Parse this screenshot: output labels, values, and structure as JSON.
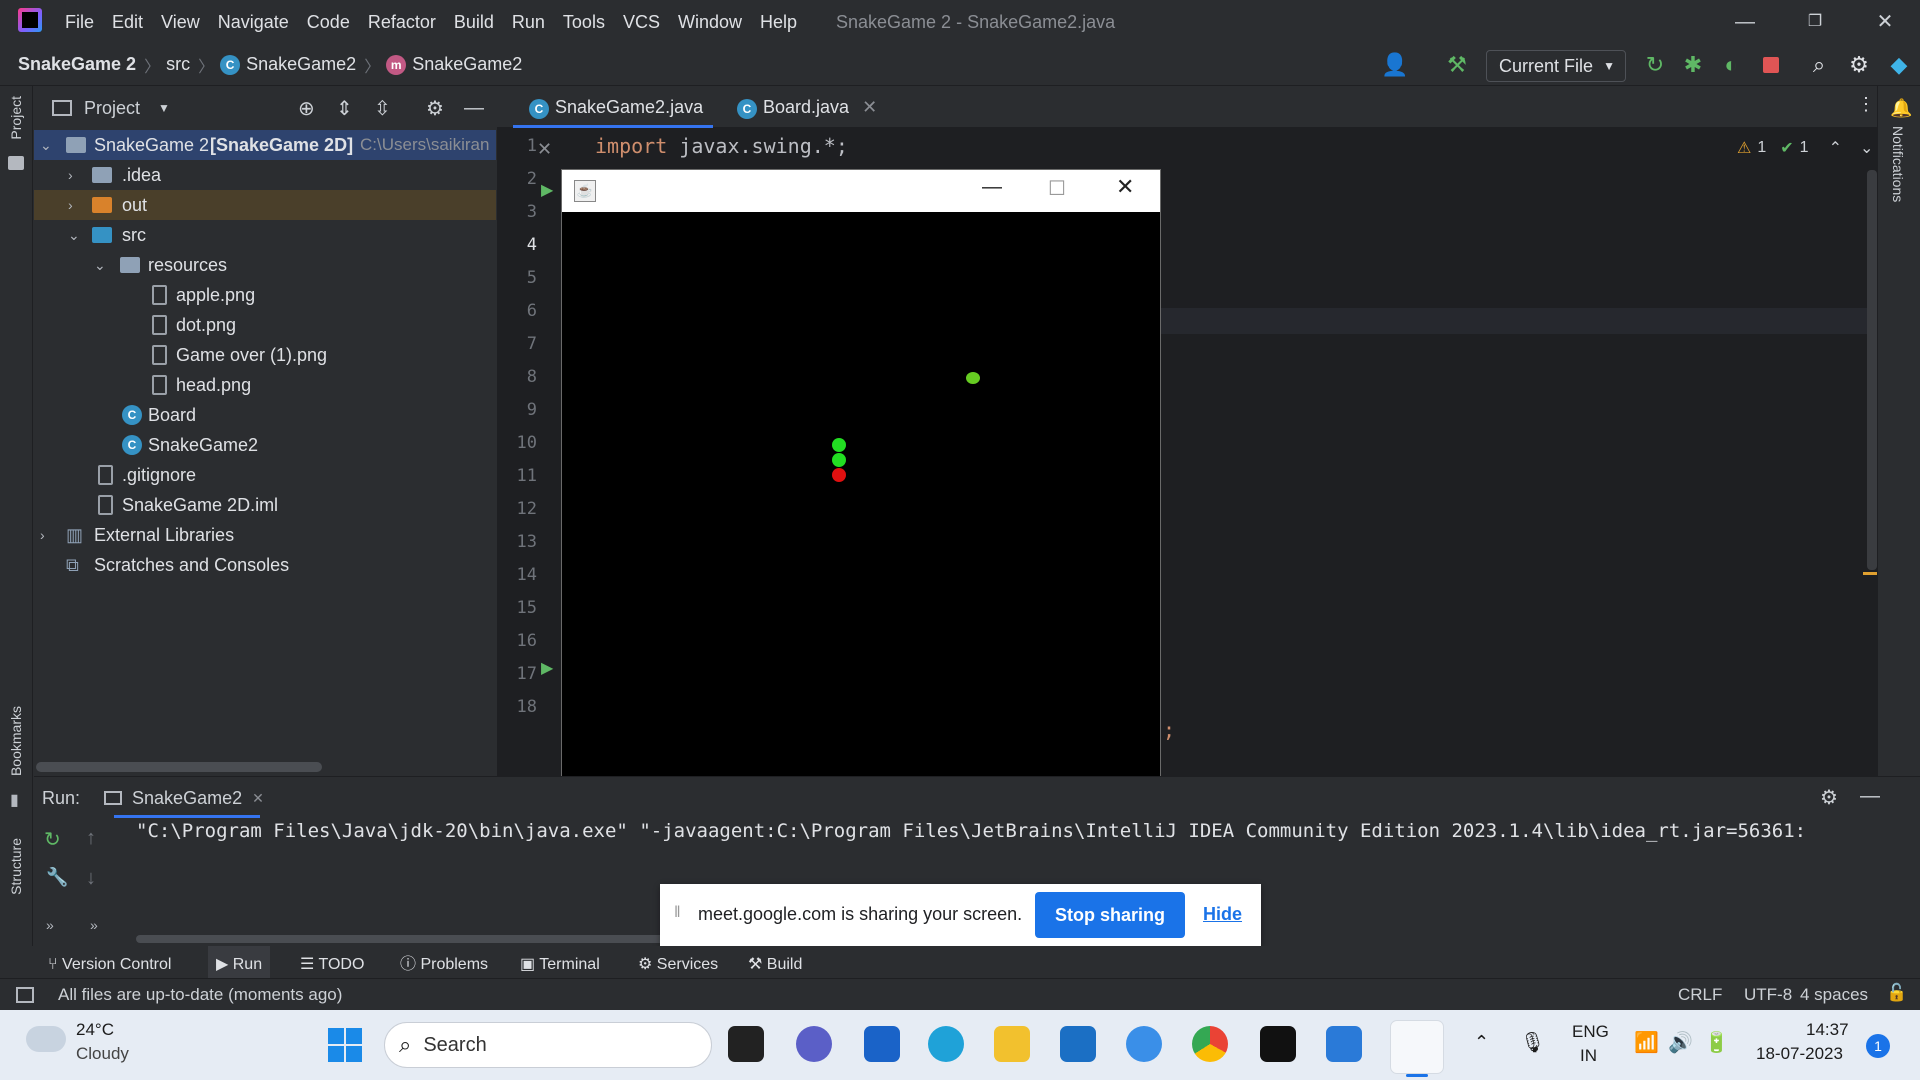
{
  "menu": [
    "File",
    "Edit",
    "View",
    "Navigate",
    "Code",
    "Refactor",
    "Build",
    "Run",
    "Tools",
    "VCS",
    "Window",
    "Help"
  ],
  "window_title": "SnakeGame 2 - SnakeGame2.java",
  "breadcrumb": {
    "project": "SnakeGame 2",
    "src": "src",
    "class1": "SnakeGame2",
    "class2": "SnakeGame2"
  },
  "run_config": "Current File",
  "left_stripe": {
    "project": "Project",
    "bookmarks": "Bookmarks",
    "structure": "Structure"
  },
  "right_stripe": {
    "notifications": "Notifications"
  },
  "project_panel": {
    "title": "Project",
    "root_name": "SnakeGame 2",
    "root_module": "[SnakeGame 2D]",
    "root_path": "C:\\Users\\saikiran",
    "items": [
      {
        "label": "SnakeGame 2",
        "type": "root"
      },
      {
        "label": ".idea",
        "type": "folder"
      },
      {
        "label": "out",
        "type": "folder"
      },
      {
        "label": "src",
        "type": "folder"
      },
      {
        "label": "resources",
        "type": "folder"
      },
      {
        "label": "apple.png",
        "type": "file"
      },
      {
        "label": "dot.png",
        "type": "file"
      },
      {
        "label": "Game over (1).png",
        "type": "file"
      },
      {
        "label": "head.png",
        "type": "file"
      },
      {
        "label": "Board",
        "type": "class"
      },
      {
        "label": "SnakeGame2",
        "type": "class"
      },
      {
        "label": ".gitignore",
        "type": "file"
      },
      {
        "label": "SnakeGame 2D.iml",
        "type": "file"
      },
      {
        "label": "External Libraries",
        "type": "lib"
      },
      {
        "label": "Scratches and Consoles",
        "type": "scratch"
      }
    ]
  },
  "editor": {
    "tabs": [
      {
        "label": "SnakeGame2.java"
      },
      {
        "label": "Board.java"
      }
    ],
    "line_numbers": [
      "1",
      "2",
      "3",
      "4",
      "5",
      "6",
      "7",
      "8",
      "9",
      "10",
      "11",
      "12",
      "13",
      "14",
      "15",
      "16",
      "17",
      "18"
    ],
    "code_keyword": "import",
    "code_rest": " javax.swing.*;",
    "warnings": "1",
    "checks": "1",
    "trailing_semicolon": ";"
  },
  "run_panel": {
    "label": "Run:",
    "tab": "SnakeGame2",
    "console": "\"C:\\Program Files\\Java\\jdk-20\\bin\\java.exe\" \"-javaagent:C:\\Program Files\\JetBrains\\IntelliJ IDEA Community Edition 2023.1.4\\lib\\idea_rt.jar=56361:"
  },
  "meet_banner": {
    "text": "meet.google.com is sharing your screen.",
    "stop": "Stop sharing",
    "hide": "Hide"
  },
  "tool_windows": [
    "Version Control",
    "Run",
    "TODO",
    "Problems",
    "Terminal",
    "Services",
    "Build"
  ],
  "status_bar": {
    "message": "All files are up-to-date (moments ago)",
    "line_sep": "CRLF",
    "encoding": "UTF-8",
    "indent": "4 spaces"
  },
  "taskbar": {
    "weather_temp": "24°C",
    "weather_desc": "Cloudy",
    "search": "Search",
    "lang1": "ENG",
    "lang2": "IN",
    "time": "14:37",
    "date": "18-07-2023",
    "notif_count": "1"
  },
  "colors": {
    "snake_body": "#22dd22",
    "snake_head": "#e01010",
    "apple": "#66cc22",
    "accent": "#3574f0"
  }
}
